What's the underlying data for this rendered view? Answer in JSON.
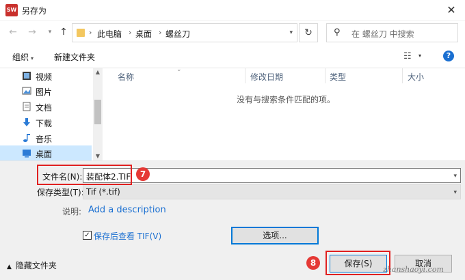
{
  "window": {
    "title": "另存为",
    "app_icon_text": "SW"
  },
  "address": {
    "breadcrumbs": [
      "此电脑",
      "桌面",
      "螺丝刀"
    ],
    "search_placeholder": "在 螺丝刀 中搜索"
  },
  "toolbar": {
    "organize_label": "组织",
    "new_folder_label": "新建文件夹"
  },
  "nav_pane": {
    "items": [
      {
        "label": "视频",
        "icon": "video-icon"
      },
      {
        "label": "图片",
        "icon": "pictures-icon"
      },
      {
        "label": "文档",
        "icon": "documents-icon"
      },
      {
        "label": "下载",
        "icon": "download-icon"
      },
      {
        "label": "音乐",
        "icon": "music-icon"
      },
      {
        "label": "桌面",
        "icon": "desktop-icon",
        "selected": true
      }
    ]
  },
  "file_list": {
    "columns": [
      "名称",
      "修改日期",
      "类型",
      "大小"
    ],
    "empty_message": "没有与搜索条件匹配的项。"
  },
  "form": {
    "filename_label": "文件名(N):",
    "filename_value": "装配体2.TIF",
    "type_label": "保存类型(T):",
    "type_value": "Tif (*.tif)",
    "desc_label": "说明:",
    "desc_link": "Add a description",
    "view_after_save_label": "保存后查看 TIF(V)",
    "view_after_save_checked": true,
    "options_label": "选项...",
    "hide_folders_label": "隐藏文件夹",
    "save_label": "保存(S)",
    "cancel_label": "取消"
  },
  "annotations": {
    "step7": "7",
    "step8": "8",
    "watermark": "zhanshaoyi.com"
  },
  "colors": {
    "accent": "#0078d7",
    "annotation_red": "#e02020",
    "selected_bg": "#cce8ff",
    "link_blue": "#1a6fd1"
  }
}
